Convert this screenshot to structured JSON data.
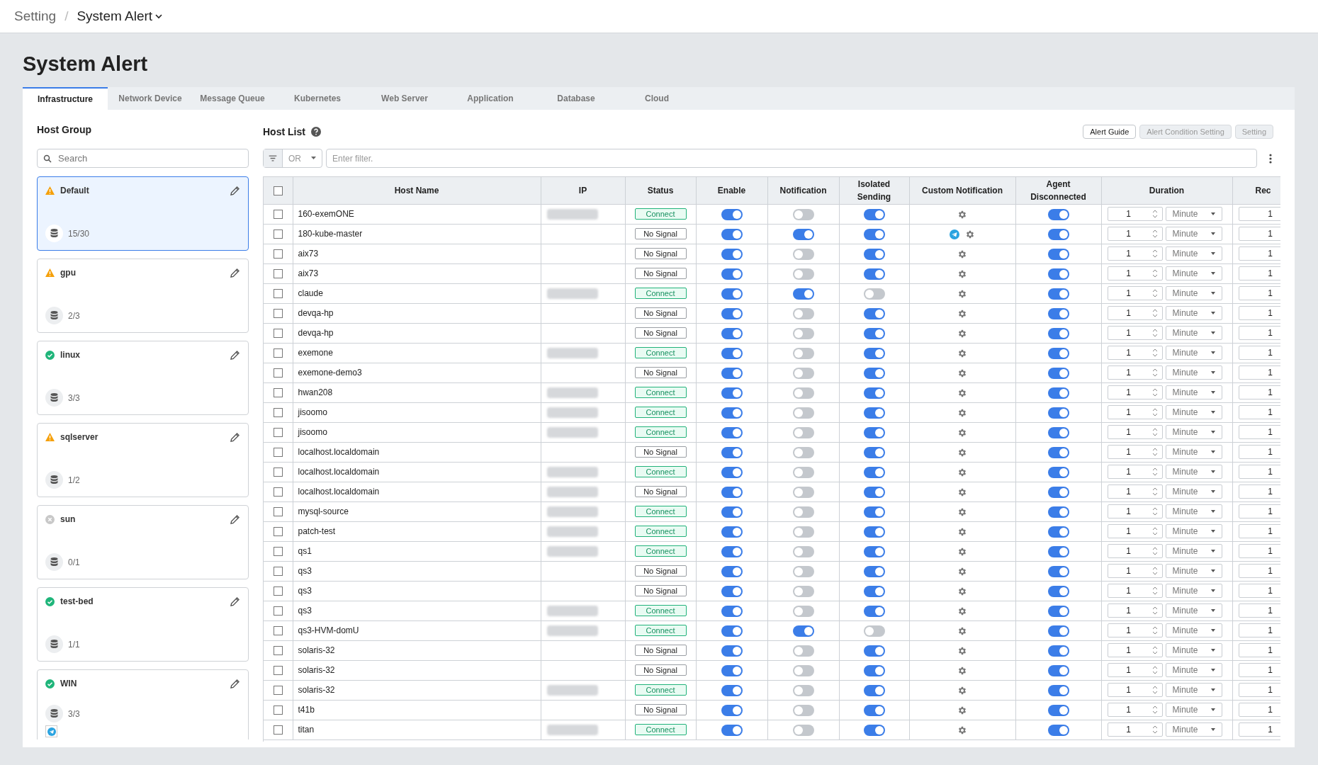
{
  "breadcrumb": {
    "parent": "Setting",
    "separator": "/",
    "current": "System Alert"
  },
  "page_title": "System Alert",
  "tabs": [
    {
      "label": "Infrastructure",
      "selected": true
    },
    {
      "label": "Network Device",
      "selected": false
    },
    {
      "label": "Message Queue",
      "selected": false
    },
    {
      "label": "Kubernetes",
      "selected": false
    },
    {
      "label": "Web Server",
      "selected": false
    },
    {
      "label": "Application",
      "selected": false
    },
    {
      "label": "Database",
      "selected": false
    },
    {
      "label": "Cloud",
      "selected": false
    }
  ],
  "host_group": {
    "title": "Host Group",
    "search": {
      "placeholder": "Search"
    },
    "groups": [
      {
        "name": "Default",
        "kind": "warning",
        "count": "15/30",
        "selected": true,
        "telegram": false
      },
      {
        "name": "gpu",
        "kind": "warning",
        "count": "2/3",
        "selected": false,
        "telegram": false
      },
      {
        "name": "linux",
        "kind": "ok",
        "count": "3/3",
        "selected": false,
        "telegram": false
      },
      {
        "name": "sqlserver",
        "kind": "warning",
        "count": "1/2",
        "selected": false,
        "telegram": false
      },
      {
        "name": "sun",
        "kind": "inactive",
        "count": "0/1",
        "selected": false,
        "telegram": false
      },
      {
        "name": "test-bed",
        "kind": "ok",
        "count": "1/1",
        "selected": false,
        "telegram": false
      },
      {
        "name": "WIN",
        "kind": "ok",
        "count": "3/3",
        "selected": false,
        "telegram": true
      }
    ]
  },
  "host_list": {
    "title": "Host List",
    "buttons": [
      {
        "label": "Alert Guide",
        "disabled": false
      },
      {
        "label": "Alert Condition Setting",
        "disabled": true
      },
      {
        "label": "Setting",
        "disabled": true
      }
    ],
    "filter": {
      "operator": "OR",
      "placeholder": "Enter filter."
    },
    "table": {
      "columns": [
        "Host Name",
        "IP",
        "Status",
        "Enable",
        "Notification",
        "Isolated Sending",
        "Custom Notification",
        "Agent Disconnected",
        "Duration",
        "Rec"
      ],
      "select_all_checked": false,
      "rows": [
        {
          "checked": false,
          "host": "160-exemONE",
          "ip_masked": true,
          "status": {
            "kind": "connect",
            "label": "Connect"
          },
          "enable": true,
          "notification": false,
          "isolated": true,
          "telegram": false,
          "agent": true,
          "duration": "1",
          "unit": "Minute",
          "rec": "1"
        },
        {
          "checked": false,
          "host": "180-kube-master",
          "ip_masked": false,
          "status": {
            "kind": "no_signal",
            "label": "No Signal"
          },
          "enable": true,
          "notification": true,
          "isolated": true,
          "telegram": true,
          "agent": true,
          "duration": "1",
          "unit": "Minute",
          "rec": "1"
        },
        {
          "checked": false,
          "host": "aix73",
          "ip_masked": false,
          "status": {
            "kind": "no_signal",
            "label": "No Signal"
          },
          "enable": true,
          "notification": false,
          "isolated": true,
          "telegram": false,
          "agent": true,
          "duration": "1",
          "unit": "Minute",
          "rec": "1"
        },
        {
          "checked": false,
          "host": "aix73",
          "ip_masked": false,
          "status": {
            "kind": "no_signal",
            "label": "No Signal"
          },
          "enable": true,
          "notification": false,
          "isolated": true,
          "telegram": false,
          "agent": true,
          "duration": "1",
          "unit": "Minute",
          "rec": "1"
        },
        {
          "checked": false,
          "host": "claude",
          "ip_masked": true,
          "status": {
            "kind": "connect",
            "label": "Connect"
          },
          "enable": true,
          "notification": true,
          "isolated": false,
          "telegram": false,
          "agent": true,
          "duration": "1",
          "unit": "Minute",
          "rec": "1"
        },
        {
          "checked": false,
          "host": "devqa-hp",
          "ip_masked": false,
          "status": {
            "kind": "no_signal",
            "label": "No Signal"
          },
          "enable": true,
          "notification": false,
          "isolated": true,
          "telegram": false,
          "agent": true,
          "duration": "1",
          "unit": "Minute",
          "rec": "1"
        },
        {
          "checked": false,
          "host": "devqa-hp",
          "ip_masked": false,
          "status": {
            "kind": "no_signal",
            "label": "No Signal"
          },
          "enable": true,
          "notification": false,
          "isolated": true,
          "telegram": false,
          "agent": true,
          "duration": "1",
          "unit": "Minute",
          "rec": "1"
        },
        {
          "checked": false,
          "host": "exemone",
          "ip_masked": true,
          "status": {
            "kind": "connect",
            "label": "Connect"
          },
          "enable": true,
          "notification": false,
          "isolated": true,
          "telegram": false,
          "agent": true,
          "duration": "1",
          "unit": "Minute",
          "rec": "1"
        },
        {
          "checked": false,
          "host": "exemone-demo3",
          "ip_masked": false,
          "status": {
            "kind": "no_signal",
            "label": "No Signal"
          },
          "enable": true,
          "notification": false,
          "isolated": true,
          "telegram": false,
          "agent": true,
          "duration": "1",
          "unit": "Minute",
          "rec": "1"
        },
        {
          "checked": false,
          "host": "hwan208",
          "ip_masked": true,
          "status": {
            "kind": "connect",
            "label": "Connect"
          },
          "enable": true,
          "notification": false,
          "isolated": true,
          "telegram": false,
          "agent": true,
          "duration": "1",
          "unit": "Minute",
          "rec": "1"
        },
        {
          "checked": false,
          "host": "jisoomo",
          "ip_masked": true,
          "status": {
            "kind": "connect",
            "label": "Connect"
          },
          "enable": true,
          "notification": false,
          "isolated": true,
          "telegram": false,
          "agent": true,
          "duration": "1",
          "unit": "Minute",
          "rec": "1"
        },
        {
          "checked": false,
          "host": "jisoomo",
          "ip_masked": true,
          "status": {
            "kind": "connect",
            "label": "Connect"
          },
          "enable": true,
          "notification": false,
          "isolated": true,
          "telegram": false,
          "agent": true,
          "duration": "1",
          "unit": "Minute",
          "rec": "1"
        },
        {
          "checked": false,
          "host": "localhost.localdomain",
          "ip_masked": false,
          "status": {
            "kind": "no_signal",
            "label": "No Signal"
          },
          "enable": true,
          "notification": false,
          "isolated": true,
          "telegram": false,
          "agent": true,
          "duration": "1",
          "unit": "Minute",
          "rec": "1"
        },
        {
          "checked": false,
          "host": "localhost.localdomain",
          "ip_masked": true,
          "status": {
            "kind": "connect",
            "label": "Connect"
          },
          "enable": true,
          "notification": false,
          "isolated": true,
          "telegram": false,
          "agent": true,
          "duration": "1",
          "unit": "Minute",
          "rec": "1"
        },
        {
          "checked": false,
          "host": "localhost.localdomain",
          "ip_masked": true,
          "status": {
            "kind": "no_signal",
            "label": "No Signal"
          },
          "enable": true,
          "notification": false,
          "isolated": true,
          "telegram": false,
          "agent": true,
          "duration": "1",
          "unit": "Minute",
          "rec": "1"
        },
        {
          "checked": false,
          "host": "mysql-source",
          "ip_masked": true,
          "status": {
            "kind": "connect",
            "label": "Connect"
          },
          "enable": true,
          "notification": false,
          "isolated": true,
          "telegram": false,
          "agent": true,
          "duration": "1",
          "unit": "Minute",
          "rec": "1"
        },
        {
          "checked": false,
          "host": "patch-test",
          "ip_masked": true,
          "status": {
            "kind": "connect",
            "label": "Connect"
          },
          "enable": true,
          "notification": false,
          "isolated": true,
          "telegram": false,
          "agent": true,
          "duration": "1",
          "unit": "Minute",
          "rec": "1"
        },
        {
          "checked": false,
          "host": "qs1",
          "ip_masked": true,
          "status": {
            "kind": "connect",
            "label": "Connect"
          },
          "enable": true,
          "notification": false,
          "isolated": true,
          "telegram": false,
          "agent": true,
          "duration": "1",
          "unit": "Minute",
          "rec": "1"
        },
        {
          "checked": false,
          "host": "qs3",
          "ip_masked": false,
          "status": {
            "kind": "no_signal",
            "label": "No Signal"
          },
          "enable": true,
          "notification": false,
          "isolated": true,
          "telegram": false,
          "agent": true,
          "duration": "1",
          "unit": "Minute",
          "rec": "1"
        },
        {
          "checked": false,
          "host": "qs3",
          "ip_masked": false,
          "status": {
            "kind": "no_signal",
            "label": "No Signal"
          },
          "enable": true,
          "notification": false,
          "isolated": true,
          "telegram": false,
          "agent": true,
          "duration": "1",
          "unit": "Minute",
          "rec": "1"
        },
        {
          "checked": false,
          "host": "qs3",
          "ip_masked": true,
          "status": {
            "kind": "connect",
            "label": "Connect"
          },
          "enable": true,
          "notification": false,
          "isolated": true,
          "telegram": false,
          "agent": true,
          "duration": "1",
          "unit": "Minute",
          "rec": "1"
        },
        {
          "checked": false,
          "host": "qs3-HVM-domU",
          "ip_masked": true,
          "status": {
            "kind": "connect",
            "label": "Connect"
          },
          "enable": true,
          "notification": true,
          "isolated": false,
          "telegram": false,
          "agent": true,
          "duration": "1",
          "unit": "Minute",
          "rec": "1"
        },
        {
          "checked": false,
          "host": "solaris-32",
          "ip_masked": false,
          "status": {
            "kind": "no_signal",
            "label": "No Signal"
          },
          "enable": true,
          "notification": false,
          "isolated": true,
          "telegram": false,
          "agent": true,
          "duration": "1",
          "unit": "Minute",
          "rec": "1"
        },
        {
          "checked": false,
          "host": "solaris-32",
          "ip_masked": false,
          "status": {
            "kind": "no_signal",
            "label": "No Signal"
          },
          "enable": true,
          "notification": false,
          "isolated": true,
          "telegram": false,
          "agent": true,
          "duration": "1",
          "unit": "Minute",
          "rec": "1"
        },
        {
          "checked": false,
          "host": "solaris-32",
          "ip_masked": true,
          "status": {
            "kind": "connect",
            "label": "Connect"
          },
          "enable": true,
          "notification": false,
          "isolated": true,
          "telegram": false,
          "agent": true,
          "duration": "1",
          "unit": "Minute",
          "rec": "1"
        },
        {
          "checked": false,
          "host": "t41b",
          "ip_masked": false,
          "status": {
            "kind": "no_signal",
            "label": "No Signal"
          },
          "enable": true,
          "notification": false,
          "isolated": true,
          "telegram": false,
          "agent": true,
          "duration": "1",
          "unit": "Minute",
          "rec": "1"
        },
        {
          "checked": false,
          "host": "titan",
          "ip_masked": true,
          "status": {
            "kind": "connect",
            "label": "Connect"
          },
          "enable": true,
          "notification": false,
          "isolated": true,
          "telegram": false,
          "agent": true,
          "duration": "1",
          "unit": "Minute",
          "rec": "1"
        }
      ]
    }
  }
}
